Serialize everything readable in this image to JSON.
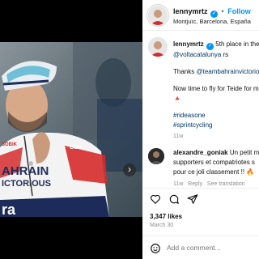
{
  "post": {
    "username": "lennymrtz",
    "follow_label": "Follow",
    "location": "Montjuïc, Barcelona, España"
  },
  "caption": {
    "username": "lennymrtz",
    "line1": "5th place in the",
    "line2": "@voltacatalunya",
    "line2_tail": "rs",
    "line3_prefix": "Thanks",
    "line3_link": "@teambahrainvictorio",
    "line4": "Now time to fly for Teide for m",
    "line5": "🔺",
    "tag1": "#rideasone",
    "tag2": "#sprintcycling",
    "age": "11w"
  },
  "comment": {
    "username": "alexandre_goniak",
    "line1": "Un petit m",
    "line2": "supporters et compatriotes s",
    "line3": "pour ce joli classement !! 🔥",
    "age": "11w",
    "reply_label": "Reply",
    "translation_label": "See translation"
  },
  "actions": {
    "likes": "3,347 likes",
    "date": "March 30",
    "add_comment_placeholder": "Add a comment..."
  },
  "icons": {
    "next": "chevron-right-icon",
    "like": "heart-icon",
    "comment": "comment-bubble-icon",
    "share": "paper-plane-icon",
    "emoji": "smiley-icon",
    "verified": "verified-badge-icon"
  },
  "colors": {
    "accent": "#0095f6",
    "link": "#00376b",
    "jersey_red": "#d62b2b",
    "jersey_navy": "#1d2b5a"
  },
  "photo": {
    "jersey_text1": "AHRAIN",
    "jersey_text2": "ICTORIOUS",
    "jersey_text3": "ra",
    "jersey_text4": "SOBIK",
    "jersey_text5": "ODX"
  }
}
